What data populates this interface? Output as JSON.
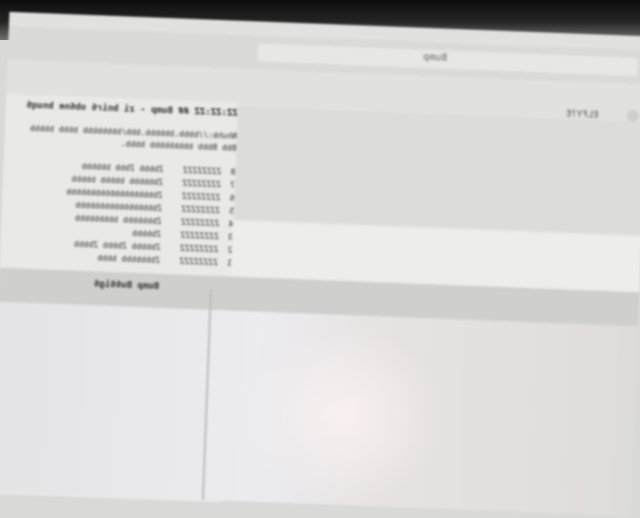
{
  "window": {
    "title": "Bump",
    "corner_label": "ELFY?E"
  },
  "message": {
    "header": "ZZ:ZZ:ZZ ## Bump - zi bnir6 ob6ne bnuq6",
    "body_lines": [
      "Nhuhb://bbbb.bbbbbb.bbb/bbbbbbbb bbbb bbbbb",
      "Bbb Bbbb bbbbbbbbb bbbb."
    ]
  },
  "log": [
    {
      "num": "8",
      "date": "ZZZZZZZZ",
      "desc": "Zbbbb Zbbb bbbbbb"
    },
    {
      "num": "7",
      "date": "ZZZZZZZZ",
      "desc": "Zbbbbbb bbbbb bbbbb"
    },
    {
      "num": "6",
      "date": "ZZZZZZZZ",
      "desc": "Zbbbbbbbbbbbbbbbbbbb"
    },
    {
      "num": "5",
      "date": "ZZZZZZZZ",
      "desc": "Zbbbbbbbbbbbbbbbbb"
    },
    {
      "num": "4",
      "date": "ZZZZZZZZ",
      "desc": "Zbbbbbbb bbbbbbbbb"
    },
    {
      "num": "3",
      "date": "ZZZZZZZZ",
      "desc": "Zbbbbb"
    },
    {
      "num": "2",
      "date": "ZZZZZZZZ",
      "desc": "Zbbbbb Zbbbb Zbbbb"
    },
    {
      "num": "1",
      "date": "ZZZZZZZZ",
      "desc": "Zbbbbbbb bbbb"
    }
  ],
  "section": {
    "label": "Bump Bu66ig6"
  }
}
